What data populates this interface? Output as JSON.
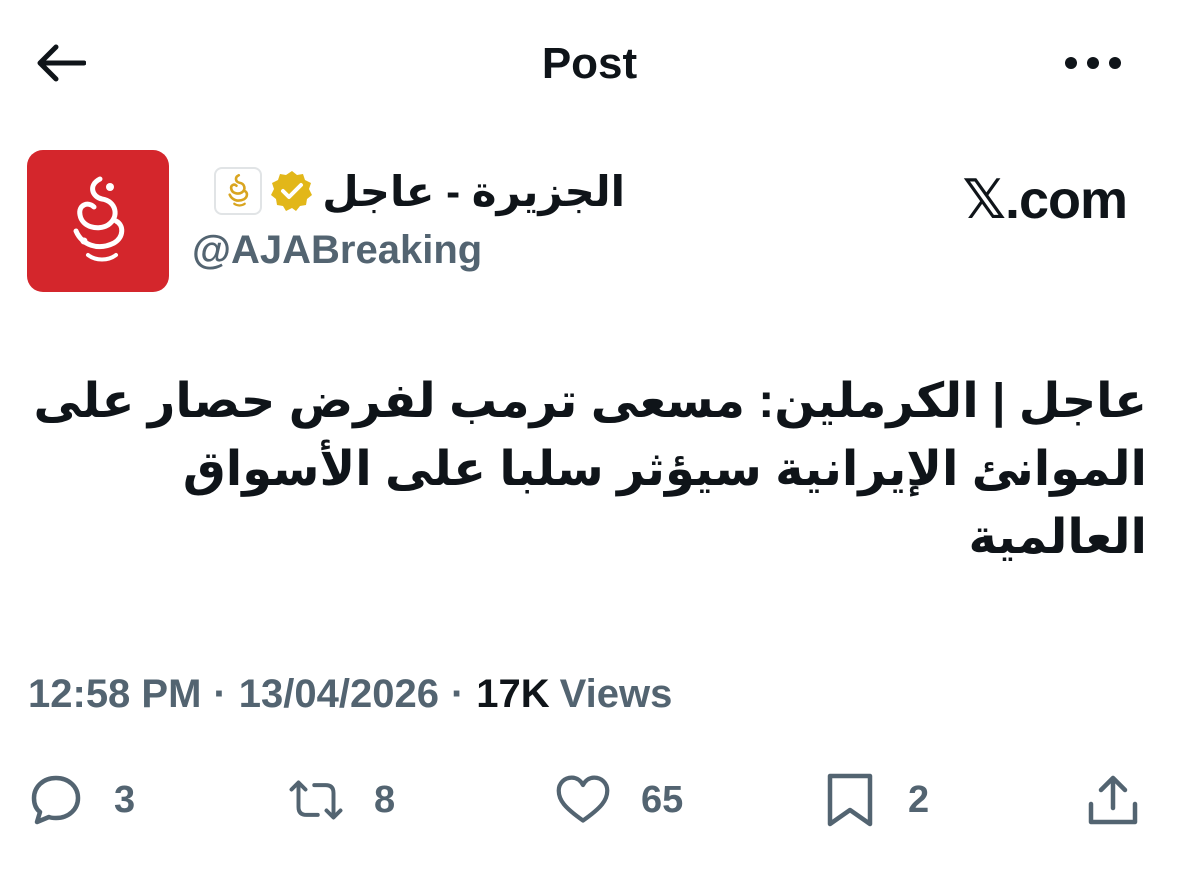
{
  "header": {
    "title": "Post",
    "back_icon": "arrow-left-icon",
    "more_icon": "more-horizontal-icon"
  },
  "author": {
    "display_name": "الجزيرة - عاجل",
    "handle": "@AJABreaking",
    "verified_icon": "verified-badge-icon",
    "affiliate_icon": "aljazeera-logo-icon",
    "avatar_icon": "aljazeera-logo-icon",
    "avatar_bg": "#d4262c",
    "verified_color": "#e2b719"
  },
  "watermark": "𝕏.com",
  "tweet": {
    "text_line_1": "عاجل | الكرملين: مسعى ترمب لفرض حصار على",
    "text_line_2": "الموانئ الإيرانية سيؤثر سلبا على الأسواق",
    "text_line_3": "العالمية"
  },
  "meta": {
    "time": "12:58 PM",
    "separator": "·",
    "date": "13/04/2026",
    "views_count": "17K",
    "views_label": "Views"
  },
  "actions": {
    "replies": "3",
    "reposts": "8",
    "likes": "65",
    "bookmarks": "2"
  },
  "colors": {
    "text": "#0f1419",
    "secondary": "#536471"
  }
}
